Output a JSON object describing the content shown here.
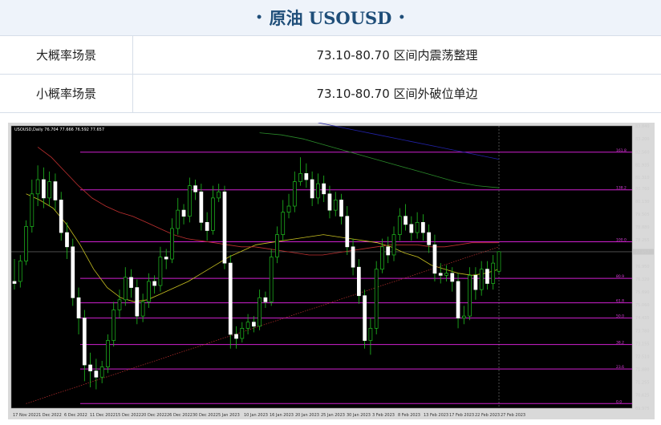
{
  "header": {
    "title": "原油  USOUSD",
    "bullet": "•"
  },
  "scenarios": [
    {
      "label": "大概率场景",
      "value": "73.10-80.70 区间内震荡整理"
    },
    {
      "label": "小概率场景",
      "value": "73.10-80.70 区间外破位单边"
    }
  ],
  "chart_data": {
    "type": "candlestick",
    "header_text": "USOUSD,Daily 76.704 77.666 76.592 77.657",
    "price_labels": [
      "83.840",
      "83.200",
      "82.560",
      "81.935",
      "81.310",
      "80.760",
      "80.130",
      "79.505",
      "78.880",
      "78.255",
      "77.657",
      "76.950",
      "76.320",
      "75.690",
      "75.060",
      "74.435",
      "73.780",
      "73.155",
      "72.510",
      "71.880",
      "71.255",
      "70.625",
      "69.975"
    ],
    "ylim": [
      69.975,
      83.84
    ],
    "date_labels": [
      "17 Nov 2022",
      "1 Dec 2022",
      "6 Dec 2022",
      "11 Dec 2022",
      "15 Dec 2022",
      "20 Dec 2022",
      "26 Dec 2022",
      "30 Dec 2022",
      "5 Jan 2023",
      "10 Jan 2023",
      "16 Jan 2023",
      "20 Jan 2023",
      "25 Jan 2023",
      "30 Jan 2023",
      "3 Feb 2023",
      "8 Feb 2023",
      "13 Feb 2023",
      "17 Feb 2023",
      "22 Feb 2023",
      "27 Feb 2023"
    ],
    "fib_levels": [
      {
        "price": 82.55,
        "label": "161.8"
      },
      {
        "price": 80.7,
        "label": "138.2"
      },
      {
        "price": 78.15,
        "label": "100.0"
      },
      {
        "price": 76.35,
        "label": "80.9"
      },
      {
        "price": 75.15,
        "label": "61.8"
      },
      {
        "price": 74.4,
        "label": "50.0"
      },
      {
        "price": 73.1,
        "label": "38.2"
      },
      {
        "price": 71.9,
        "label": "23.6"
      },
      {
        "price": 70.2,
        "label": "0.0"
      }
    ],
    "current_price": 77.657,
    "candles": [
      [
        76.2,
        76.1,
        77.3,
        75.8
      ],
      [
        76.2,
        77.2,
        77.5,
        75.9
      ],
      [
        77.2,
        78.9,
        79.2,
        77.0
      ],
      [
        78.9,
        80.5,
        81.2,
        78.6
      ],
      [
        80.5,
        81.2,
        81.9,
        79.9
      ],
      [
        81.2,
        80.3,
        81.8,
        79.8
      ],
      [
        80.3,
        81.1,
        81.6,
        79.9
      ],
      [
        81.1,
        80.2,
        81.5,
        79.7
      ],
      [
        80.2,
        78.6,
        80.6,
        78.2
      ],
      [
        78.6,
        77.9,
        79.1,
        77.3
      ],
      [
        77.9,
        75.4,
        78.3,
        75.0
      ],
      [
        75.4,
        74.4,
        75.9,
        73.6
      ],
      [
        74.4,
        72.1,
        74.8,
        71.3
      ],
      [
        72.1,
        71.8,
        72.7,
        71.0
      ],
      [
        71.8,
        71.5,
        72.4,
        70.9
      ],
      [
        71.5,
        72.0,
        72.3,
        71.2
      ],
      [
        72.0,
        73.3,
        73.6,
        71.7
      ],
      [
        73.3,
        74.8,
        75.2,
        73.0
      ],
      [
        74.8,
        75.3,
        75.8,
        74.4
      ],
      [
        75.3,
        76.4,
        76.9,
        75.0
      ],
      [
        76.4,
        75.9,
        76.8,
        75.4
      ],
      [
        75.9,
        74.5,
        76.3,
        74.1
      ],
      [
        74.5,
        75.2,
        75.6,
        74.2
      ],
      [
        75.2,
        76.2,
        76.6,
        74.9
      ],
      [
        76.2,
        76.0,
        76.5,
        75.6
      ],
      [
        76.0,
        77.4,
        77.9,
        75.7
      ],
      [
        77.4,
        77.3,
        77.8,
        76.8
      ],
      [
        77.3,
        78.8,
        79.3,
        77.1
      ],
      [
        78.8,
        79.7,
        80.3,
        78.5
      ],
      [
        79.7,
        79.4,
        80.0,
        79.0
      ],
      [
        79.4,
        80.9,
        81.3,
        79.1
      ],
      [
        80.9,
        80.6,
        81.2,
        80.2
      ],
      [
        80.6,
        79.1,
        81.0,
        78.7
      ],
      [
        79.1,
        78.7,
        79.6,
        78.2
      ],
      [
        78.7,
        80.3,
        80.9,
        78.5
      ],
      [
        80.3,
        80.6,
        81.0,
        80.1
      ],
      [
        80.6,
        77.1,
        80.9,
        76.8
      ],
      [
        77.1,
        73.6,
        77.5,
        72.9
      ],
      [
        73.6,
        73.4,
        74.0,
        72.9
      ],
      [
        73.4,
        73.9,
        74.2,
        73.2
      ],
      [
        73.9,
        74.2,
        74.6,
        73.6
      ],
      [
        74.2,
        74.0,
        74.5,
        73.7
      ],
      [
        74.0,
        75.4,
        75.8,
        73.8
      ],
      [
        75.4,
        75.2,
        75.7,
        74.9
      ],
      [
        75.2,
        77.4,
        77.8,
        75.0
      ],
      [
        77.4,
        78.5,
        78.9,
        77.1
      ],
      [
        78.5,
        79.6,
        80.2,
        78.2
      ],
      [
        79.6,
        79.9,
        80.5,
        79.3
      ],
      [
        79.9,
        81.1,
        81.6,
        79.6
      ],
      [
        81.1,
        81.5,
        82.3,
        80.9
      ],
      [
        81.5,
        81.2,
        82.0,
        80.8
      ],
      [
        81.2,
        80.3,
        81.6,
        79.9
      ],
      [
        80.3,
        81.0,
        81.5,
        80.0
      ],
      [
        81.0,
        80.5,
        81.4,
        80.1
      ],
      [
        80.5,
        79.7,
        80.9,
        79.3
      ],
      [
        79.7,
        80.2,
        80.6,
        79.4
      ],
      [
        80.2,
        79.4,
        80.5,
        79.0
      ],
      [
        79.4,
        77.9,
        79.9,
        77.5
      ],
      [
        77.9,
        76.9,
        78.3,
        76.5
      ],
      [
        76.9,
        75.5,
        77.3,
        75.1
      ],
      [
        75.5,
        73.3,
        75.8,
        72.9
      ],
      [
        73.3,
        73.9,
        74.4,
        72.6
      ],
      [
        73.9,
        76.8,
        77.2,
        73.6
      ],
      [
        76.8,
        77.9,
        78.3,
        76.6
      ],
      [
        77.9,
        77.5,
        78.4,
        77.1
      ],
      [
        77.5,
        78.5,
        78.9,
        77.2
      ],
      [
        78.5,
        79.4,
        79.8,
        78.2
      ],
      [
        79.4,
        79.0,
        80.0,
        78.7
      ],
      [
        79.0,
        78.6,
        79.4,
        78.2
      ],
      [
        78.6,
        79.1,
        79.6,
        78.3
      ],
      [
        79.1,
        78.6,
        79.5,
        78.2
      ],
      [
        78.6,
        78.0,
        79.0,
        77.6
      ],
      [
        78.0,
        76.6,
        78.5,
        76.2
      ],
      [
        76.6,
        76.5,
        77.1,
        76.1
      ],
      [
        76.5,
        76.6,
        77.0,
        76.2
      ],
      [
        76.6,
        76.2,
        76.9,
        75.7
      ],
      [
        76.2,
        74.4,
        76.6,
        73.9
      ],
      [
        74.4,
        74.5,
        75.0,
        74.1
      ],
      [
        74.5,
        76.5,
        76.9,
        74.3
      ],
      [
        76.5,
        75.8,
        76.9,
        75.3
      ],
      [
        75.8,
        76.8,
        77.2,
        75.5
      ],
      [
        76.8,
        76.1,
        77.2,
        75.8
      ],
      [
        76.1,
        77.1,
        77.5,
        75.8
      ],
      [
        76.7,
        77.66,
        77.67,
        76.59
      ]
    ],
    "ma_yellow": [
      80.5,
      80.2,
      79.8,
      79.0,
      78.0,
      76.8,
      75.9,
      75.4,
      75.2,
      75.3,
      75.6,
      75.9,
      76.2,
      76.6,
      77.0,
      77.4,
      77.7,
      78.0,
      78.1,
      78.2,
      78.3,
      78.4,
      78.5,
      78.4,
      78.3,
      78.2,
      78.1,
      77.9,
      77.6,
      77.4,
      77.0,
      76.8,
      76.6,
      76.5,
      76.6,
      76.8
    ],
    "ma_red": [
      82.8,
      82.3,
      81.6,
      80.9,
      80.3,
      79.9,
      79.6,
      79.4,
      79.1,
      78.8,
      78.5,
      78.3,
      78.2,
      78.1,
      78.0,
      77.9,
      77.9,
      77.8,
      77.7,
      77.6,
      77.5,
      77.5,
      77.6,
      77.7,
      77.8,
      77.9,
      78.0,
      78.0,
      78.0,
      77.9,
      77.9,
      78.0,
      78.1,
      78.1,
      78.1
    ],
    "ma_green": [
      83.5,
      83.4,
      83.2,
      82.9,
      82.6,
      82.3,
      82.0,
      81.7,
      81.4,
      81.1,
      80.9,
      80.8
    ],
    "ma_blue": [
      84.0,
      83.7,
      83.4,
      83.1,
      82.8,
      82.5,
      82.2
    ],
    "trend_dotted": [
      [
        2,
        70.2
      ],
      [
        83,
        77.9
      ]
    ]
  }
}
